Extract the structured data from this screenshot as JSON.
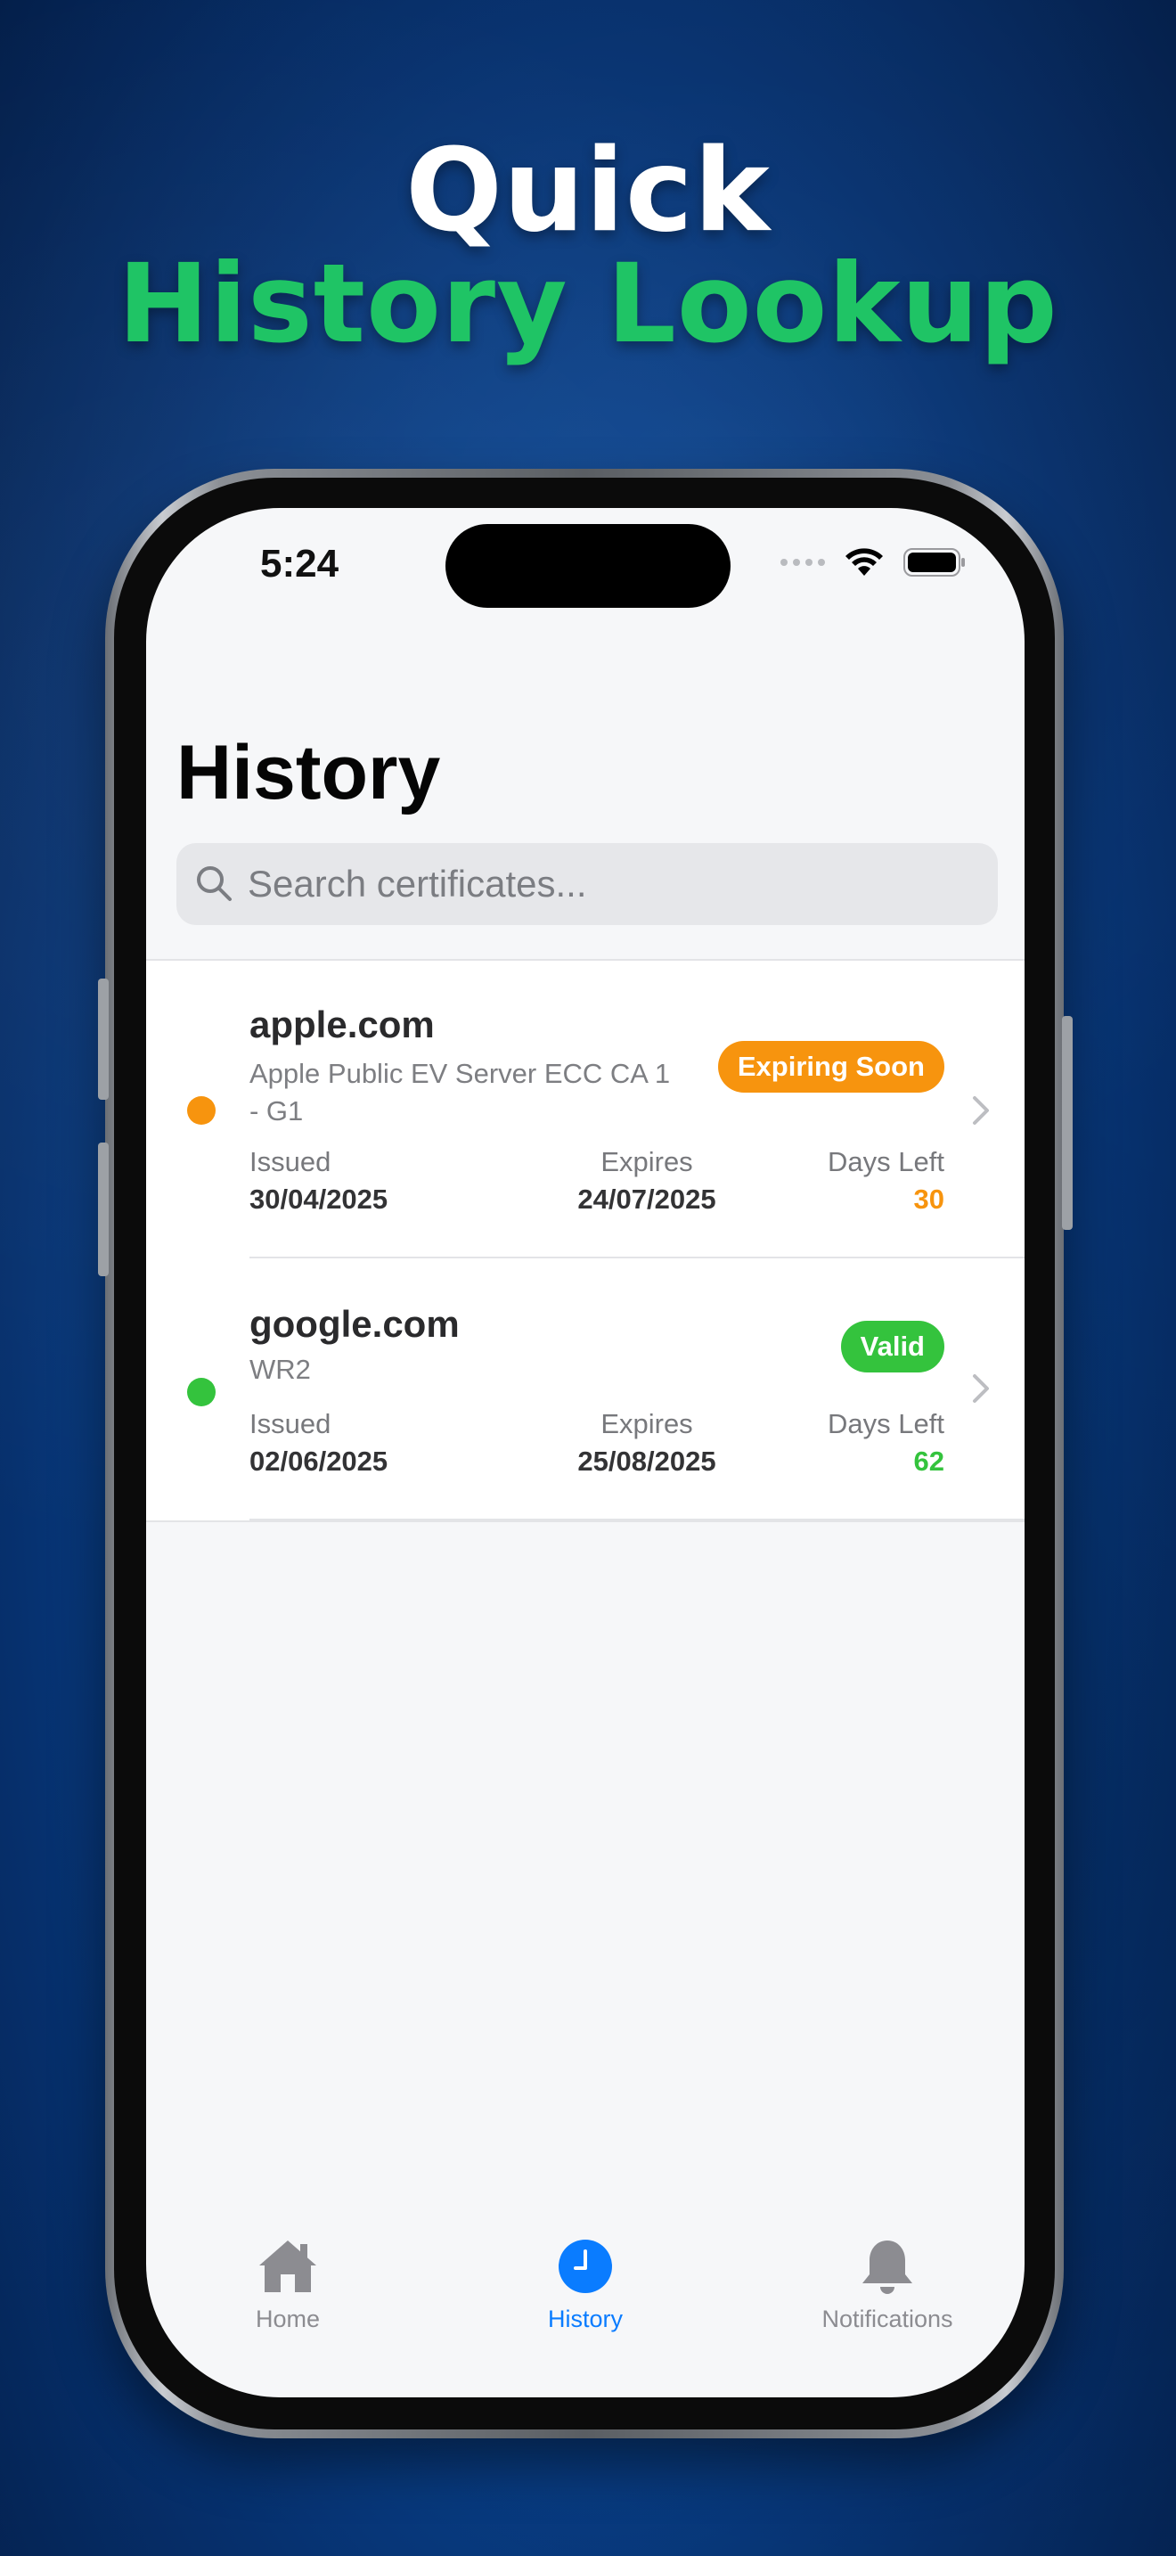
{
  "headline": {
    "line1": "Quick",
    "line2": "History Lookup"
  },
  "status_bar": {
    "time": "5:24"
  },
  "page": {
    "title": "History"
  },
  "search": {
    "placeholder": "Search certificates..."
  },
  "columns": {
    "issued": "Issued",
    "expires": "Expires",
    "days_left": "Days Left"
  },
  "certificates": [
    {
      "domain": "apple.com",
      "issuer_line1": "Apple Public EV Server ECC CA 1",
      "issuer_line2": "- G1",
      "status": "Expiring Soon",
      "status_color": "#f7940e",
      "issued": "30/04/2025",
      "expires": "24/07/2025",
      "days_left": "30"
    },
    {
      "domain": "google.com",
      "issuer_line1": "WR2",
      "status": "Valid",
      "status_color": "#34c33d",
      "issued": "02/06/2025",
      "expires": "25/08/2025",
      "days_left": "62"
    }
  ],
  "tabs": [
    {
      "label": "Home",
      "icon": "house-icon",
      "active": false
    },
    {
      "label": "History",
      "icon": "clock-icon",
      "active": true
    },
    {
      "label": "Notifications",
      "icon": "bell-icon",
      "active": false
    }
  ],
  "colors": {
    "accent": "#0a7cff",
    "headline_green": "#1fc465",
    "expiring": "#f7940e",
    "valid": "#34c33d",
    "tab_inactive": "#8c8c91"
  }
}
